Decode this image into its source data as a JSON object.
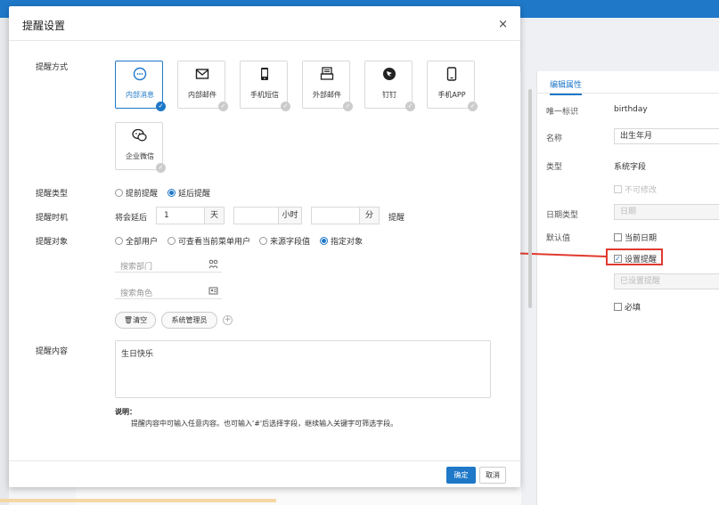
{
  "dialog": {
    "title": "提醒设置",
    "close": "×",
    "ok_label": "确定",
    "cancel_label": "取消"
  },
  "method": {
    "label": "提醒方式",
    "options": [
      {
        "label": "内部消息",
        "icon": "message-icon",
        "active": true
      },
      {
        "label": "内部邮件",
        "icon": "mail-icon",
        "active": false
      },
      {
        "label": "手机短信",
        "icon": "phone-icon",
        "active": false
      },
      {
        "label": "外部邮件",
        "icon": "external-mail-icon",
        "active": false
      },
      {
        "label": "钉钉",
        "icon": "dingtalk-icon",
        "active": false
      },
      {
        "label": "手机APP",
        "icon": "mobile-app-icon",
        "active": false
      },
      {
        "label": "企业微信",
        "icon": "wechat-work-icon",
        "active": false
      }
    ]
  },
  "type": {
    "label": "提醒类型",
    "options": [
      {
        "label": "提前提醒",
        "selected": false
      },
      {
        "label": "延后提醒",
        "selected": true
      }
    ]
  },
  "time": {
    "label": "提醒时机",
    "prefix": "将会延后",
    "day_value": "1",
    "day_unit": "天",
    "hour_value": "",
    "hour_unit": "小时",
    "minute_value": "",
    "minute_unit": "分",
    "suffix": "提醒"
  },
  "target": {
    "label": "提醒对象",
    "options": [
      {
        "label": "全部用户",
        "selected": false
      },
      {
        "label": "可查看当前菜单用户",
        "selected": false
      },
      {
        "label": "来源字段值",
        "selected": false
      },
      {
        "label": "指定对象",
        "selected": true
      }
    ],
    "dept_placeholder": "搜索部门",
    "role_placeholder": "搜索角色",
    "clear_label": "清空",
    "tag_label": "系统管理员"
  },
  "content": {
    "label": "提醒内容",
    "value": "生日快乐",
    "note_title": "说明：",
    "note_body": "提醒内容中可输入任意内容。也可输入'#'后选择字段，继续输入关键字可筛选字段。"
  },
  "right_panel": {
    "tab": "编辑属性",
    "id_label": "唯一标识",
    "id_value": "birthday",
    "name_label": "名称",
    "name_value": "出生年月",
    "type_label": "类型",
    "type_value": "系统字段",
    "readonly_label": "不可修改",
    "date_type_label": "日期类型",
    "date_type_value": "日期",
    "default_label": "默认值",
    "current_date_label": "当前日期",
    "reminder_label": "设置提醒",
    "reminder_status": "已设置提醒",
    "required_label": "必填"
  },
  "colors": {
    "accent": "#1f78c8",
    "highlight": "#e03a2f"
  }
}
